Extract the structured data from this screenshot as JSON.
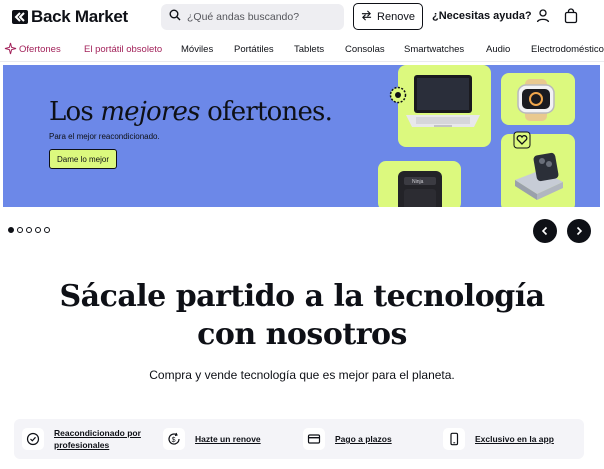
{
  "header": {
    "logo_text": "Back Market",
    "search_placeholder": "¿Qué andas buscando?",
    "renove_label": "Renove",
    "help_label": "¿Necesitas ayuda?"
  },
  "nav": {
    "items": [
      "Ofertones",
      "El portátil obsoleto",
      "Móviles",
      "Portátiles",
      "Tablets",
      "Consolas",
      "Smartwatches",
      "Audio",
      "Electrodomésticos"
    ]
  },
  "hero": {
    "title_pre": "Los ",
    "title_em": "mejores",
    "title_post": " ofertones.",
    "subtitle": "Para el mejor reacondicionado.",
    "cta_label": "Dame lo mejor",
    "product_logo": "Ninja"
  },
  "carousel": {
    "slides": 5,
    "active": 1
  },
  "main": {
    "headline_line1": "Sácale partido a la tecnología",
    "headline_line2": "con nosotros",
    "tagline": "Compra y vende tecnología que es mejor para el planeta."
  },
  "features": [
    {
      "icon": "check-badge-icon",
      "label": "Reacondicionado por profesionales"
    },
    {
      "icon": "renove-money-icon",
      "label": "Hazte un renove"
    },
    {
      "icon": "credit-card-icon",
      "label": "Pago a plazos"
    },
    {
      "icon": "phone-icon",
      "label": "Exclusivo en la app"
    }
  ],
  "colors": {
    "hero_bg": "#6c88e8",
    "accent_lime": "#dcf97e",
    "promo_text": "#a3235b",
    "ink": "#0e1016"
  }
}
